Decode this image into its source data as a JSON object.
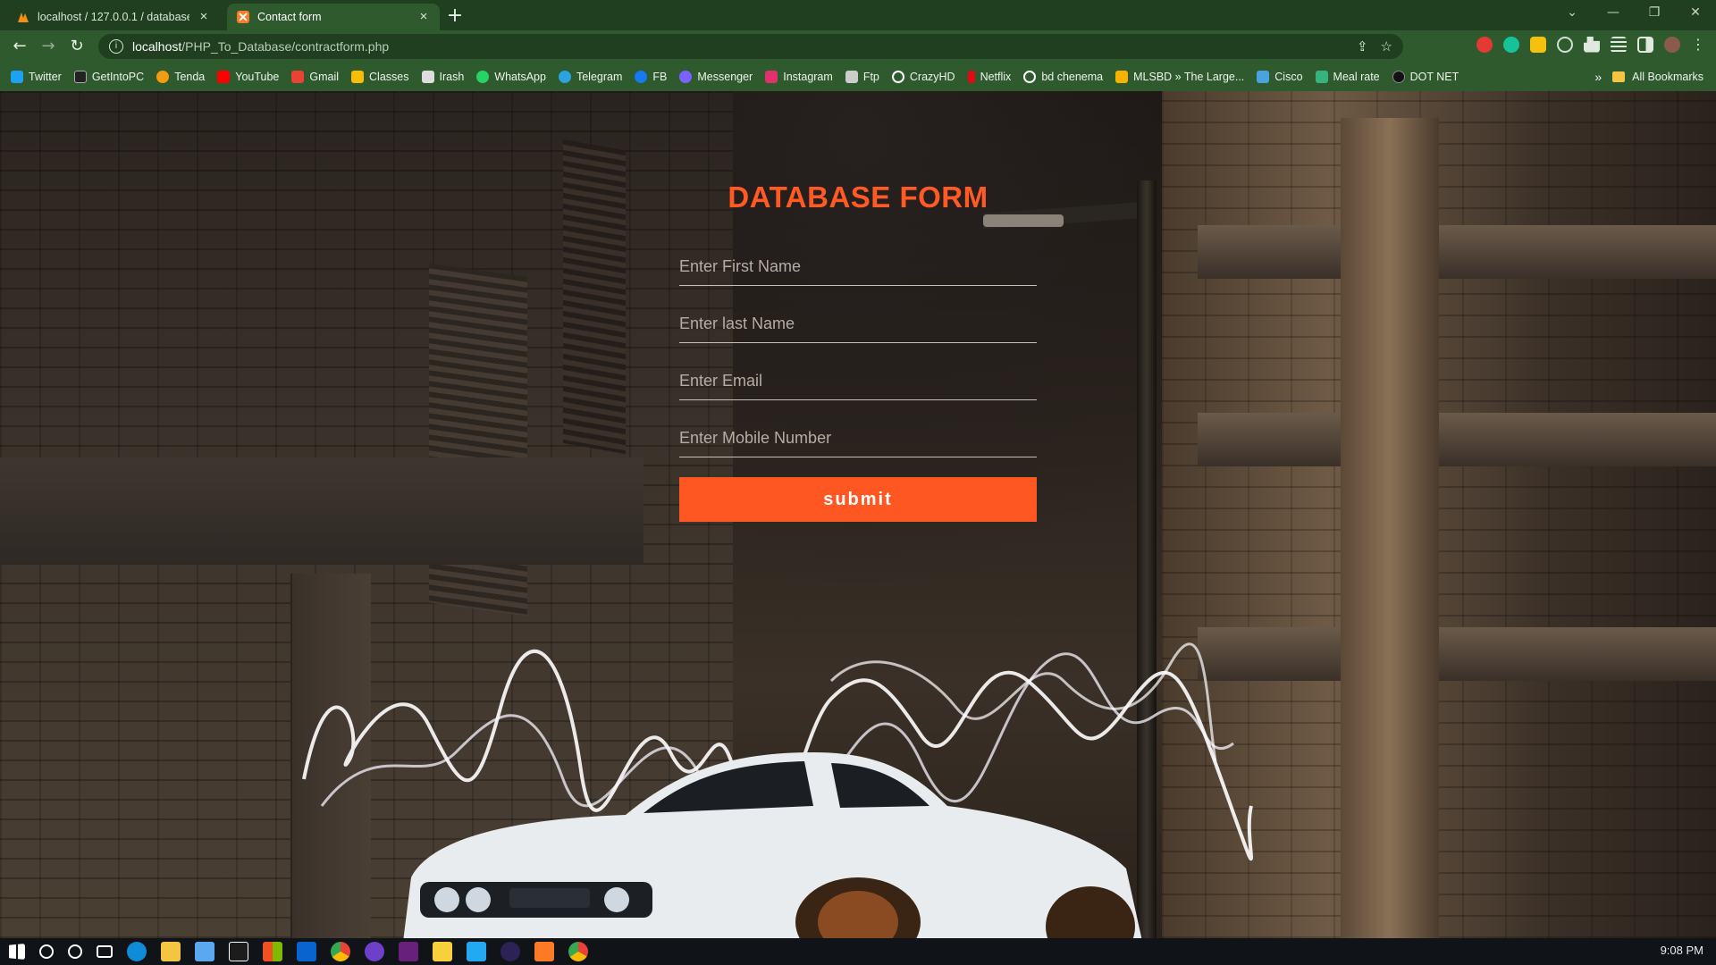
{
  "browser": {
    "tabs": [
      {
        "title": "localhost / 127.0.0.1 / database_",
        "active": false,
        "icon": "phpmyadmin-icon"
      },
      {
        "title": "Contact form",
        "active": true,
        "icon": "xampp-icon"
      }
    ],
    "address": {
      "host": "localhost",
      "path": "/PHP_To_Database/contractform.php"
    },
    "bookmarks": [
      {
        "label": "Twitter",
        "color": "#1da1f2"
      },
      {
        "label": "GetIntoPC",
        "color": "#222222"
      },
      {
        "label": "Tenda",
        "color": "#f39c12"
      },
      {
        "label": "YouTube",
        "color": "#ff0000"
      },
      {
        "label": "Gmail",
        "color": "#ea4335"
      },
      {
        "label": "Classes",
        "color": "#fbbc04"
      },
      {
        "label": "Irash",
        "color": "#dddddd"
      },
      {
        "label": "WhatsApp",
        "color": "#25d366"
      },
      {
        "label": "Telegram",
        "color": "#2aa3df"
      },
      {
        "label": "FB",
        "color": "#1877f2"
      },
      {
        "label": "Messenger",
        "color": "#7b61ff"
      },
      {
        "label": "Instagram",
        "color": "#e1306c"
      },
      {
        "label": "Ftp",
        "color": "#cccccc"
      },
      {
        "label": "CrazyHD",
        "color": "#ffffff"
      },
      {
        "label": "Netflix",
        "color": "#e50914"
      },
      {
        "label": "bd chenema",
        "color": "#ffffff"
      },
      {
        "label": "MLSBD » The Large...",
        "color": "#f6b400"
      },
      {
        "label": "Cisco",
        "color": "#4aa3df"
      },
      {
        "label": "Meal rate",
        "color": "#36b37e"
      },
      {
        "label": "DOT NET",
        "color": "#111111"
      }
    ],
    "more_label": "»",
    "all_bookmarks_label": "All Bookmarks"
  },
  "form": {
    "title": "DATABASE FORM",
    "fields": [
      {
        "placeholder": "Enter First Name"
      },
      {
        "placeholder": "Enter last Name"
      },
      {
        "placeholder": "Enter Email"
      },
      {
        "placeholder": "Enter Mobile Number"
      }
    ],
    "submit_label": "submit",
    "accent_color": "#ff5722"
  },
  "taskbar": {
    "clock": "9:08 PM"
  }
}
